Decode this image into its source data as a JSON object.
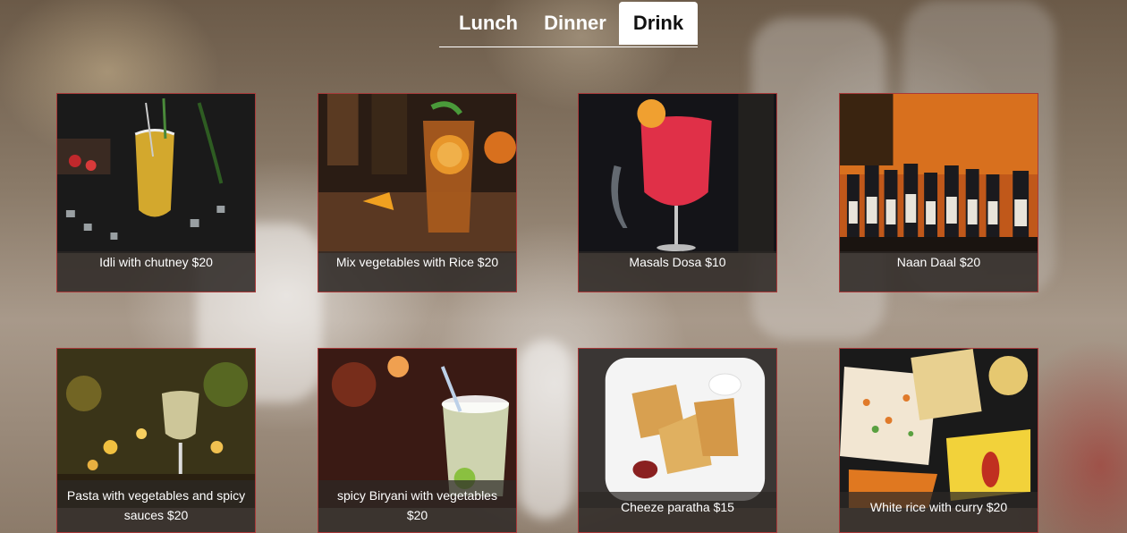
{
  "nav": {
    "tabs": [
      {
        "label": "Lunch",
        "active": false
      },
      {
        "label": "Dinner",
        "active": false
      },
      {
        "label": "Drink",
        "active": true
      }
    ]
  },
  "menu": {
    "items": [
      {
        "caption": "Idli with chutney $20",
        "image": "glass-cocktail-icon"
      },
      {
        "caption": "Mix vegetables with Rice $20",
        "image": "iced-tea-icon"
      },
      {
        "caption": "Masals Dosa $10",
        "image": "red-cocktail-icon"
      },
      {
        "caption": "Naan Daal $20",
        "image": "sake-bottles-icon"
      },
      {
        "caption": "Pasta with vegetables and spicy sauces $20",
        "image": "wine-glass-icon"
      },
      {
        "caption": "spicy Biryani with vegetables $20",
        "image": "mojito-icon"
      },
      {
        "caption": "Cheeze paratha $15",
        "image": "paratha-plate-icon"
      },
      {
        "caption": "White rice with curry $20",
        "image": "curry-box-icon"
      }
    ]
  },
  "colors": {
    "card_border": "#a93a3a",
    "active_tab_bg": "#ffffff",
    "tab_text": "#ffffff"
  }
}
